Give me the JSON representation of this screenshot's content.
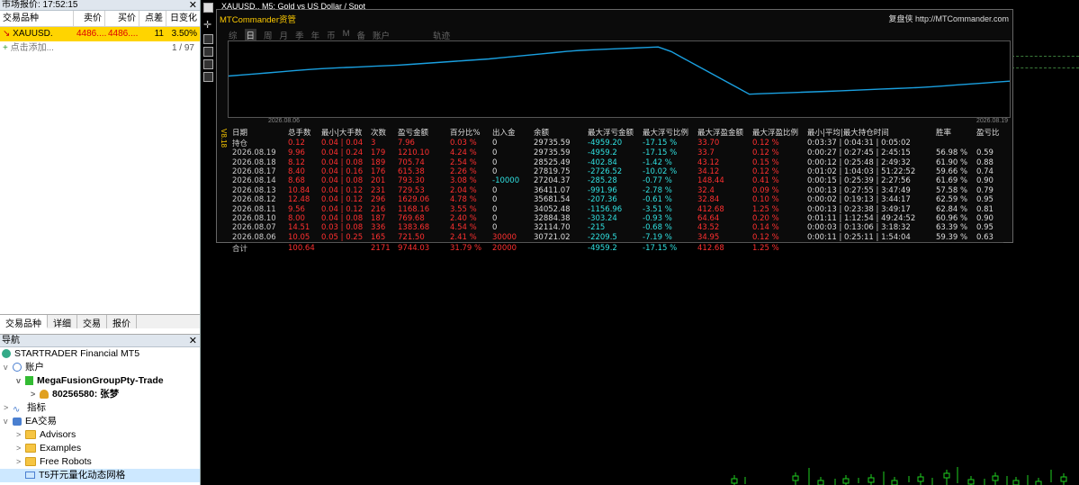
{
  "market_watch": {
    "title": "市场报价: 17:52:15",
    "headers": [
      "交易品种",
      "卖价",
      "买价",
      "点差",
      "日变化"
    ],
    "row": {
      "symbol": "XAUUSD.",
      "bid": "4486....",
      "ask": "4486....",
      "spread": "11",
      "change": "3.50%"
    },
    "add_label": "点击添加...",
    "count": "1 / 97",
    "tabs": [
      "交易品种",
      "详细",
      "交易",
      "报价"
    ]
  },
  "navigator": {
    "title": "导航",
    "items": [
      {
        "label": "STARTRADER Financial MT5"
      },
      {
        "label": "账户"
      },
      {
        "label": "MegaFusionGroupPty-Trade"
      },
      {
        "label": "80256580: 张梦"
      },
      {
        "label": "指标"
      },
      {
        "label": "EA交易"
      },
      {
        "label": "Advisors"
      },
      {
        "label": "Examples"
      },
      {
        "label": "Free Robots"
      },
      {
        "label": "T5开元量化动态网格"
      }
    ]
  },
  "chart": {
    "title": "XAUUSD., M5:  Gold vs US Dollar / Spot",
    "panel_name": "MTCommander资管",
    "panel_link": "复盘侠 http://MTCommander.com",
    "period_tabs": [
      "综",
      "日",
      "周",
      "月",
      "季",
      "年",
      "币",
      "M",
      "备",
      "账户",
      "轨迹"
    ],
    "active_tab": "日",
    "date_start": "2026.08.06",
    "date_end": "2026.08.19",
    "version": "V8.18",
    "headers": [
      "日期",
      "总手数",
      "最小|大手数",
      "次数",
      "盈亏金额",
      "百分比%",
      "出入金",
      "余额",
      "最大浮亏金额",
      "最大浮亏比例",
      "最大浮盈金额",
      "最大浮盈比例",
      "最小|平均|最大持仓时间",
      "胜率",
      "盈亏比"
    ],
    "rows": [
      [
        "持仓",
        "0.12",
        "0.04 | 0.04",
        "3",
        "7.96",
        "0.03 %",
        "0",
        "29735.59",
        "-4959.20",
        "-17.15 %",
        "33.70",
        "0.12 %",
        "0:03:37 | 0:04:31 | 0:05:02",
        "",
        ""
      ],
      [
        "2026.08.19",
        "9.96",
        "0.04 | 0.24",
        "179",
        "1210.10",
        "4.24 %",
        "0",
        "29735.59",
        "-4959.2",
        "-17.15 %",
        "33.7",
        "0.12 %",
        "0:00:27 | 0:27:45 | 2:45:15",
        "56.98 %",
        "0.59"
      ],
      [
        "2026.08.18",
        "8.12",
        "0.04 | 0.08",
        "189",
        "705.74",
        "2.54 %",
        "0",
        "28525.49",
        "-402.84",
        "-1.42 %",
        "43.12",
        "0.15 %",
        "0:00:12 | 0:25:48 | 2:49:32",
        "61.90 %",
        "0.88"
      ],
      [
        "2026.08.17",
        "8.40",
        "0.04 | 0.16",
        "176",
        "615.38",
        "2.26 %",
        "0",
        "27819.75",
        "-2726.52",
        "-10.02 %",
        "34.12",
        "0.12 %",
        "0:01:02 | 1:04:03 | 51:22:52",
        "59.66 %",
        "0.74"
      ],
      [
        "2026.08.14",
        "8.68",
        "0.04 | 0.08",
        "201",
        "793.30",
        "3.08 %",
        "-10000",
        "27204.37",
        "-285.28",
        "-0.77 %",
        "148.44",
        "0.41 %",
        "0:00:15 | 0:25:39 | 2:27:56",
        "61.69 %",
        "0.90"
      ],
      [
        "2026.08.13",
        "10.84",
        "0.04 | 0.12",
        "231",
        "729.53",
        "2.04 %",
        "0",
        "36411.07",
        "-991.96",
        "-2.78 %",
        "32.4",
        "0.09 %",
        "0:00:13 | 0:27:55 | 3:47:49",
        "57.58 %",
        "0.79"
      ],
      [
        "2026.08.12",
        "12.48",
        "0.04 | 0.12",
        "296",
        "1629.06",
        "4.78 %",
        "0",
        "35681.54",
        "-207.36",
        "-0.61 %",
        "32.84",
        "0.10 %",
        "0:00:02 | 0:19:13 | 3:44:17",
        "62.59 %",
        "0.95"
      ],
      [
        "2026.08.11",
        "9.56",
        "0.04 | 0.12",
        "216",
        "1168.16",
        "3.55 %",
        "0",
        "34052.48",
        "-1156.96",
        "-3.51 %",
        "412.68",
        "1.25 %",
        "0:00:13 | 0:23:38 | 3:49:17",
        "62.84 %",
        "0.81"
      ],
      [
        "2026.08.10",
        "8.00",
        "0.04 | 0.08",
        "187",
        "769.68",
        "2.40 %",
        "0",
        "32884.38",
        "-303.24",
        "-0.93 %",
        "64.64",
        "0.20 %",
        "0:01:11 | 1:12:54 | 49:24:52",
        "60.96 %",
        "0.90"
      ],
      [
        "2026.08.07",
        "14.51",
        "0.03 | 0.08",
        "336",
        "1383.68",
        "4.54 %",
        "0",
        "32114.70",
        "-215",
        "-0.68 %",
        "43.52",
        "0.14 %",
        "0:00:03 | 0:13:06 | 3:18:32",
        "63.39 %",
        "0.95"
      ],
      [
        "2026.08.06",
        "10.05",
        "0.05 | 0.25",
        "165",
        "721.50",
        "2.41 %",
        "30000",
        "30721.02",
        "-2209.5",
        "-7.19 %",
        "34.95",
        "0.12 %",
        "0:00:11 | 0:25:11 | 1:54:04",
        "59.39 %",
        "0.63"
      ]
    ],
    "total": [
      "合计",
      "100.64",
      "",
      "2171",
      "9744.03",
      "31.79 %",
      "20000",
      "",
      "-4959.2",
      "-17.15 %",
      "412.68",
      "1.25 %",
      "",
      "",
      ""
    ],
    "colors": {
      "loss": "#ff3030",
      "cyan": "#30e0e0",
      "line": "#1aa0e0",
      "accent": "#ffcc00"
    }
  }
}
